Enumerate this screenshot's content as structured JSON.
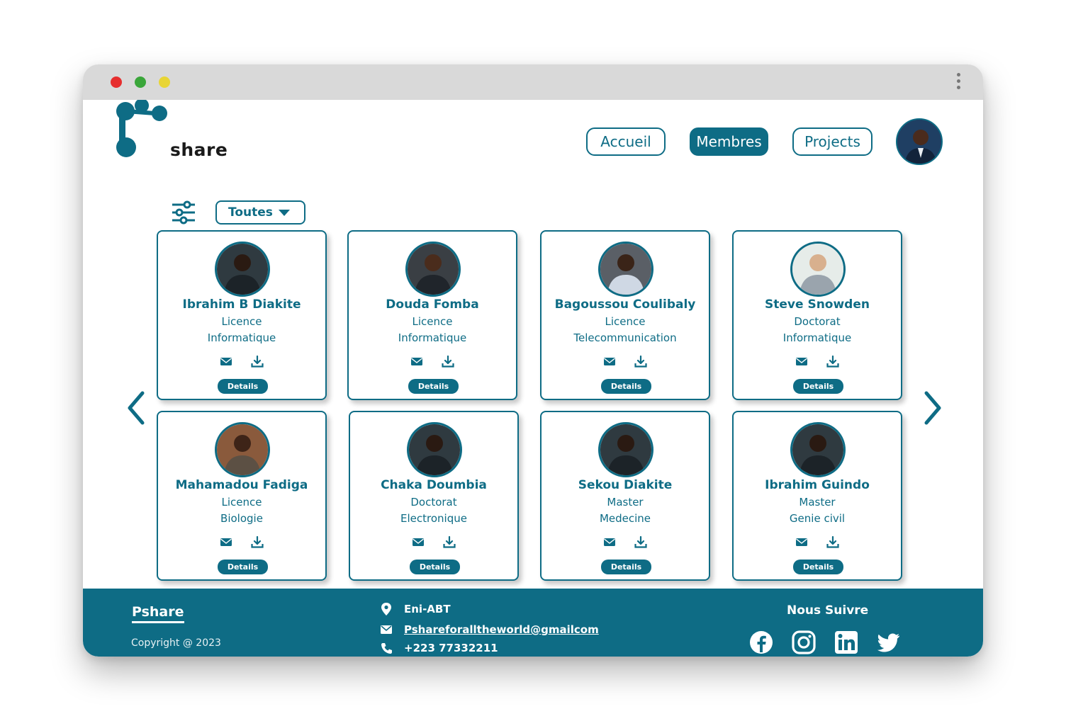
{
  "brand": {
    "name": "Pshare",
    "logo_text": "share"
  },
  "nav": {
    "items": [
      {
        "label": "Accueil",
        "active": false
      },
      {
        "label": "Membres",
        "active": true
      },
      {
        "label": "Projects",
        "active": false
      }
    ]
  },
  "filter": {
    "selected": "Toutes"
  },
  "members": [
    {
      "name": "Ibrahim B Diakite",
      "level": "Licence",
      "field": "Informatique",
      "details_label": "Details"
    },
    {
      "name": "Douda Fomba",
      "level": "Licence",
      "field": "Informatique",
      "details_label": "Details"
    },
    {
      "name": "Bagoussou Coulibaly",
      "level": "Licence",
      "field": "Telecommunication",
      "details_label": "Details"
    },
    {
      "name": "Steve Snowden",
      "level": "Doctorat",
      "field": "Informatique",
      "details_label": "Details"
    },
    {
      "name": "Mahamadou Fadiga",
      "level": "Licence",
      "field": "Biologie",
      "details_label": "Details"
    },
    {
      "name": "Chaka Doumbia",
      "level": "Doctorat",
      "field": "Electronique",
      "details_label": "Details"
    },
    {
      "name": "Sekou Diakite",
      "level": "Master",
      "field": "Medecine",
      "details_label": "Details"
    },
    {
      "name": "Ibrahim Guindo",
      "level": "Master",
      "field": "Genie civil",
      "details_label": "Details"
    }
  ],
  "footer": {
    "brand": "Pshare",
    "copyright": "Copyright @ 2023",
    "address": "Eni-ABT",
    "email": "Pshareforalltheworld@gmailcom",
    "phone": "+223 77332211",
    "follow_title": "Nous Suivre",
    "socials": [
      "facebook-icon",
      "instagram-icon",
      "linkedin-icon",
      "twitter-icon"
    ]
  },
  "colors": {
    "primary": "#0e6c85",
    "titlebar": "#d9d9d9"
  }
}
